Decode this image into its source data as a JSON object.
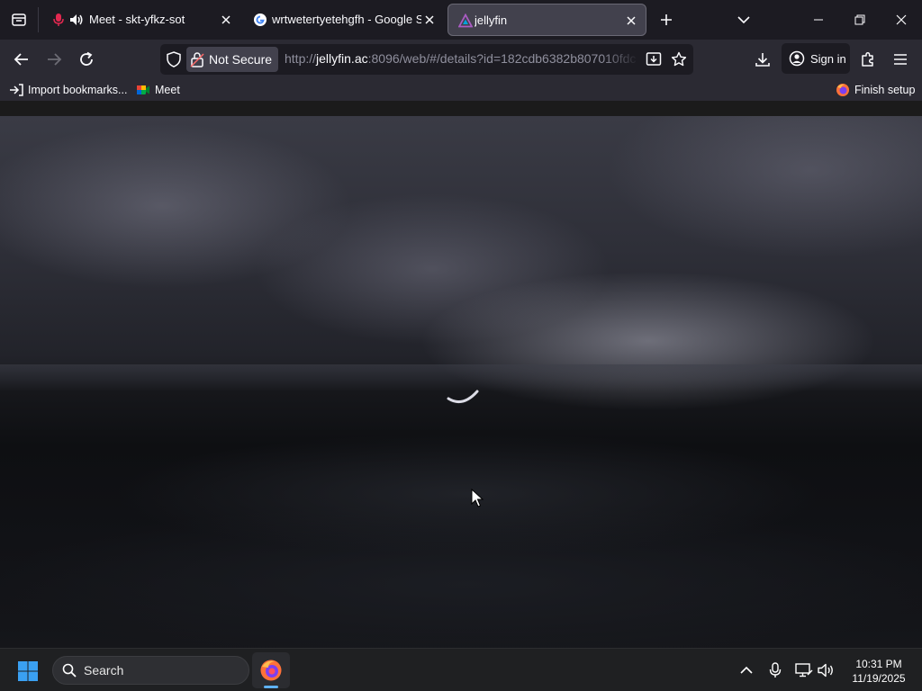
{
  "tabs": [
    {
      "label": "Meet - skt-yfkz-sot",
      "icon": "microphone-icon",
      "active": false,
      "audio": true
    },
    {
      "label": "wrtwetertyetehgfh - Google Search",
      "icon": "google-icon",
      "active": false
    },
    {
      "label": "jellyfin",
      "icon": "jellyfin-icon",
      "active": true
    }
  ],
  "navbar": {
    "security_label": "Not Secure",
    "url_prefix": "http://",
    "url_host": "jellyfin.ac",
    "url_rest": ":8096/web/#/details?id=182cdb6382b807010fdc",
    "signin_label": "Sign in"
  },
  "bookmarks": {
    "import_label": "Import bookmarks...",
    "meet_label": "Meet",
    "finish_setup_label": "Finish setup"
  },
  "content": {
    "state": "loading"
  },
  "taskbar": {
    "search_label": "Search",
    "time": "10:31 PM",
    "date": "11/19/2025"
  },
  "colors": {
    "tabstrip_bg": "#1c1b22",
    "toolbar_bg": "#2b2a33",
    "active_tab_bg": "#42414d",
    "taskbar_bg": "#1f2022",
    "jellyfin_accent": "#aa5cc3",
    "windows_blue": "#3aa0f2"
  }
}
